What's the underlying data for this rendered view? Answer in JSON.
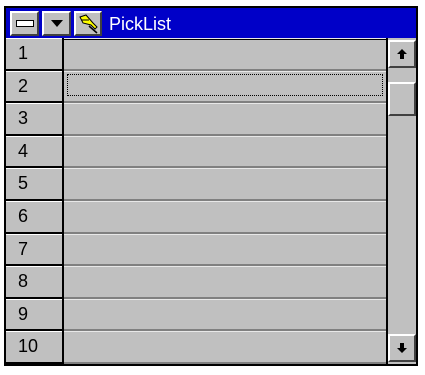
{
  "window": {
    "title": "PickList",
    "title_bar_color": "#0000c8",
    "buttons": {
      "system": "system-menu-icon",
      "dropdown": "dropdown-arrow-icon",
      "pin": "pin-icon"
    }
  },
  "rows": [
    {
      "number": "1",
      "value": ""
    },
    {
      "number": "2",
      "value": ""
    },
    {
      "number": "3",
      "value": ""
    },
    {
      "number": "4",
      "value": ""
    },
    {
      "number": "5",
      "value": ""
    },
    {
      "number": "6",
      "value": ""
    },
    {
      "number": "7",
      "value": ""
    },
    {
      "number": "8",
      "value": ""
    },
    {
      "number": "9",
      "value": ""
    },
    {
      "number": "10",
      "value": ""
    }
  ],
  "focused_row": 2,
  "scrollbar": {
    "up_icon": "arrow-up-icon",
    "down_icon": "arrow-down-icon"
  }
}
